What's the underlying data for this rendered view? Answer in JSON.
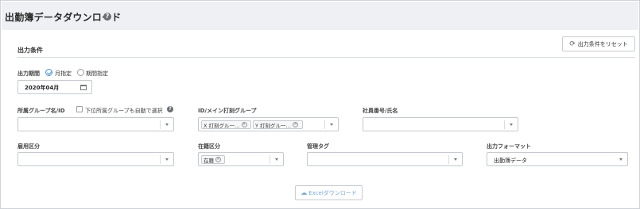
{
  "header": {
    "title": "出勤簿データダウンロード",
    "help_icon": "question-circle-icon"
  },
  "reset_button": {
    "label": "出力条件をリセット",
    "icon": "refresh-icon"
  },
  "section": {
    "title": "出力条件"
  },
  "period": {
    "label": "出力期間",
    "options": [
      {
        "label": "月指定",
        "checked": true
      },
      {
        "label": "期間指定",
        "checked": false
      }
    ],
    "month_value": "2020年04月"
  },
  "group": {
    "label": "所属グループ名/ID",
    "subgroup_checkbox_label": "下位所属グループも自動で選択",
    "value": ""
  },
  "id_group": {
    "label": "ID/メイン打刻グループ",
    "chips": [
      "X 打刻グル一…",
      "Y 打刻グル一…"
    ]
  },
  "employee": {
    "label": "社員番号/氏名",
    "value": ""
  },
  "employment": {
    "label": "雇用区分",
    "value": ""
  },
  "status": {
    "label": "在籍区分",
    "chips": [
      "在籍"
    ]
  },
  "tag": {
    "label": "管理タグ",
    "value": ""
  },
  "format": {
    "label": "出力フォーマット",
    "value": "出勤簿データ"
  },
  "excel_button": {
    "label": "Excelダウンロード",
    "icon": "cloud-download-icon"
  }
}
